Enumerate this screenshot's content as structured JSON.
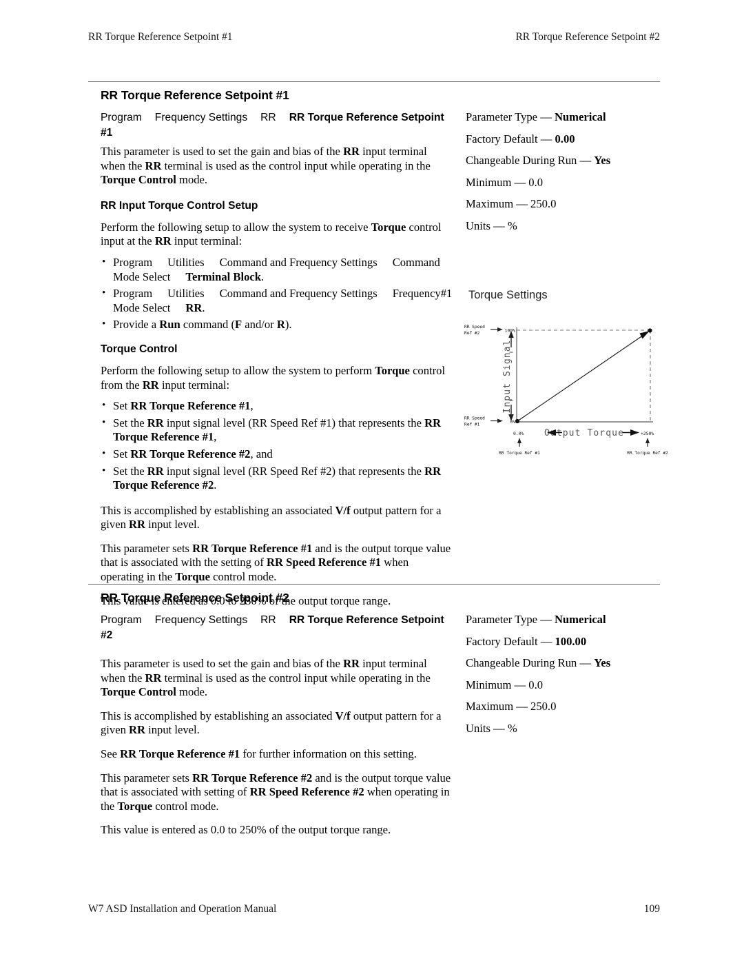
{
  "running_head": {
    "left": "RR Torque Reference Setpoint #1",
    "right": "RR Torque Reference Setpoint #2"
  },
  "footer": {
    "manual": "W7 ASD Installation and Operation Manual",
    "page_number": "109"
  },
  "section1": {
    "title": "RR Torque Reference Setpoint #1",
    "nav": {
      "c1": "Program",
      "c2": "Frequency Settings",
      "c3": "RR",
      "c4": "RR Torque Reference Setpoint #1"
    },
    "intro_p1": "This parameter is used to set the gain and bias of the ",
    "sub1": "RR Input Torque Control Setup",
    "setup_intro": "Perform the following setup to allow the system to receive ",
    "bullet1": {
      "b1": "Program",
      "b2": "Utilities",
      "b3": "Command and Frequency Settings",
      "b4": "Command Mode Select",
      "b5": "Terminal Block"
    },
    "bullet2": {
      "b1": "Program",
      "b2": "Utilities",
      "b3": "Command and Frequency Settings",
      "b4": "Frequency#1 Mode Select",
      "b5": "RR"
    },
    "bullet3": "Provide a Run command (F and/or R).",
    "sub2": "Torque Control",
    "torque_intro": "Perform the following setup to allow the system to perform Torque control from the RR input terminal:",
    "tc_bullets": [
      "Set RR Torque Reference #1,",
      "Set the RR input signal level (RR Speed Ref #1) that represents the RR Torque Reference #1,",
      "Set RR Torque Reference #2, and",
      "Set the RR input signal level (RR Speed Ref #2) that represents the RR Torque Reference #2."
    ],
    "p_vf": "This is accomplished by establishing an associated V/f output pattern for a given RR input level.",
    "p_sets": "This parameter sets RR Torque Reference #1 and is the output torque value that is associated with the setting of RR Speed Reference #1 when operating in the Torque control mode.",
    "p_range": "This value is entered as 0.0 to 250% of the output torque range.",
    "params": [
      {
        "label": "Parameter Type",
        "value": "Numerical",
        "bold": true
      },
      {
        "label": "Factory Default",
        "value": "0.00",
        "bold": true
      },
      {
        "label": "Changeable During Run",
        "value": "Yes",
        "bold": true
      },
      {
        "label": "Minimum",
        "value": "0.0",
        "bold": false
      },
      {
        "label": "Maximum",
        "value": "250.0",
        "bold": false
      },
      {
        "label": "Units",
        "value": "%",
        "bold": false
      }
    ]
  },
  "section2": {
    "title": "RR Torque Reference Setpoint #2",
    "nav": {
      "c1": "Program",
      "c2": "Frequency Settings",
      "c3": "RR",
      "c4": "RR Torque Reference Setpoint #2"
    },
    "p_vf": "This is accomplished by establishing an associated V/f output pattern for a given RR input level.",
    "p_see": "See RR Torque Reference #1 for further information on this setting.",
    "p_sets": "This parameter sets RR Torque Reference #2 and is the output torque value that is associated with setting of RR Speed Reference #2 when operating in the Torque control mode.",
    "p_range": "This value is entered as 0.0 to 250% of the output torque range.",
    "params": [
      {
        "label": "Parameter Type",
        "value": "Numerical",
        "bold": true
      },
      {
        "label": "Factory Default",
        "value": "100.00",
        "bold": true
      },
      {
        "label": "Changeable During Run",
        "value": "Yes",
        "bold": true
      },
      {
        "label": "Minimum",
        "value": "0.0",
        "bold": false
      },
      {
        "label": "Maximum",
        "value": "250.0",
        "bold": false
      },
      {
        "label": "Units",
        "value": "%",
        "bold": false
      }
    ]
  },
  "diagram": {
    "title": "Torque Settings",
    "y_axis_label": "Input Signal",
    "x_axis_label": "Output Torque",
    "y_top_tick": "100%",
    "y_bottom_tick": "0%",
    "x_left_tick": "0.0%",
    "x_right_tick": "+250%",
    "y_top_label_l1": "RR Speed",
    "y_top_label_l2": "Ref #2",
    "y_bottom_label_l1": "RR Speed",
    "y_bottom_label_l2": "Ref #1",
    "x_left_label": "RR Torque Ref #1",
    "x_right_label": "RR Torque Ref #2"
  }
}
